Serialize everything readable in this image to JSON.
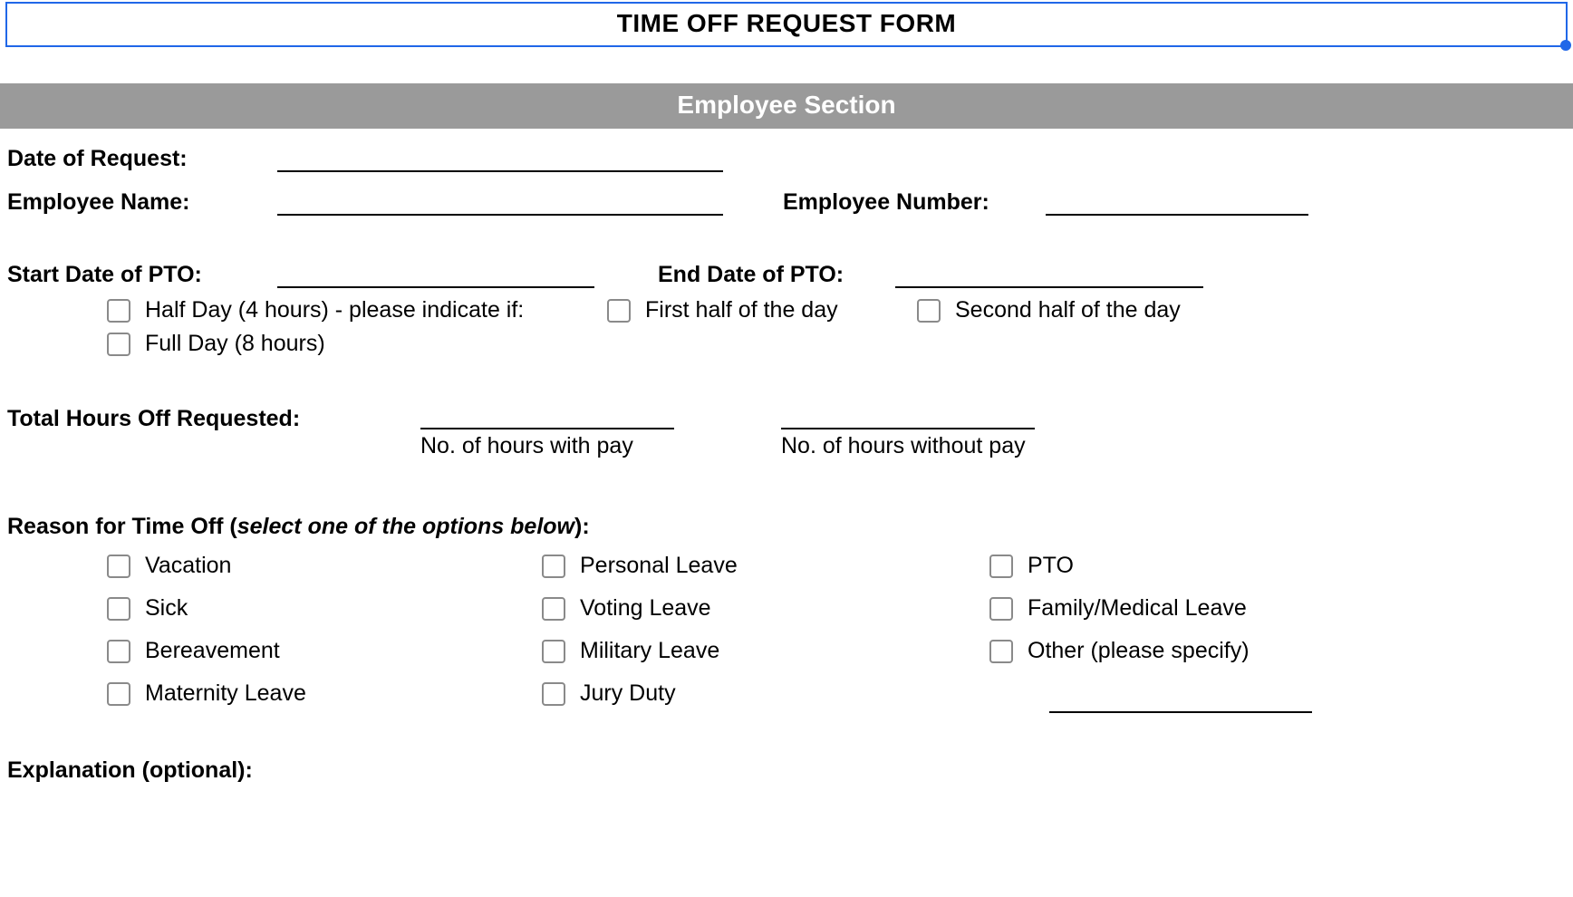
{
  "title": "TIME OFF REQUEST FORM",
  "section_header": "Employee Section",
  "labels": {
    "date_of_request": "Date of Request:",
    "employee_name": "Employee Name:",
    "employee_number": "Employee Number:",
    "start_date_pto": "Start Date of PTO:",
    "end_date_pto": "End Date of PTO:",
    "total_hours": "Total Hours Off Requested:",
    "reason_prefix": "Reason for Time Off (",
    "reason_italic": "select one of the options below",
    "reason_suffix": "):",
    "explanation": "Explanation (optional):"
  },
  "options": {
    "half_day": "Half Day (4 hours) - please indicate if:",
    "full_day": "Full Day (8 hours)",
    "first_half": "First half of the day",
    "second_half": "Second half of the day"
  },
  "captions": {
    "hours_with_pay": "No. of hours with pay",
    "hours_without_pay": "No. of hours without pay"
  },
  "reasons": {
    "col1": [
      "Vacation",
      "Sick",
      "Bereavement",
      "Maternity Leave"
    ],
    "col2": [
      "Personal Leave",
      "Voting Leave",
      "Military Leave",
      "Jury Duty"
    ],
    "col3": [
      "PTO",
      "Family/Medical Leave",
      "Other (please specify)"
    ]
  }
}
